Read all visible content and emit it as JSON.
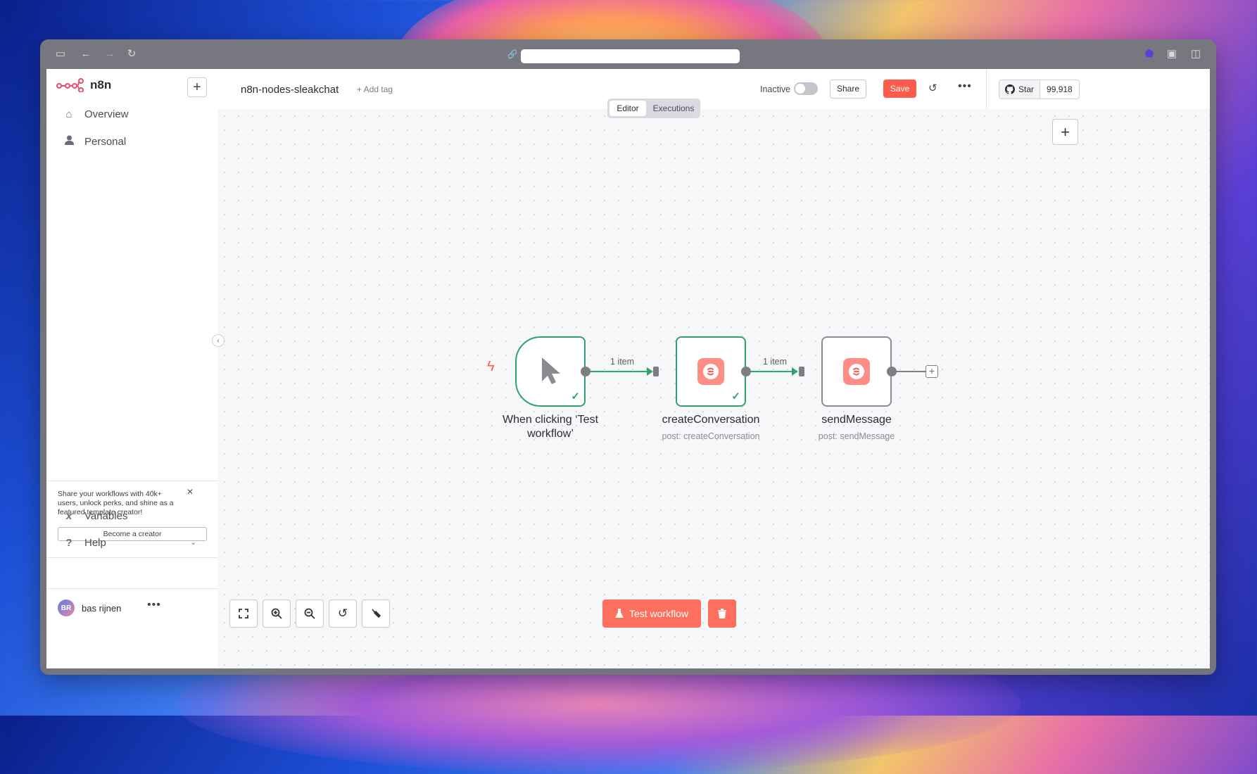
{
  "app": {
    "logo_text": "n8n"
  },
  "sidebar": {
    "items": [
      {
        "label": "Overview",
        "icon": "home-icon"
      },
      {
        "label": "Personal",
        "icon": "user-icon"
      }
    ],
    "promo": {
      "text": "Share your workflows with 40k+ users, unlock perks, and shine as a featured template creator!",
      "button_label": "Become a creator"
    },
    "bottom_items": [
      {
        "label": "Variables",
        "icon": "variables-icon"
      },
      {
        "label": "Help",
        "icon": "help-icon"
      }
    ],
    "user": {
      "initials": "BR",
      "name": "bas rijnen"
    }
  },
  "header": {
    "workflow_name": "n8n-nodes-sleakchat",
    "add_tag_label": "+ Add tag",
    "status_label": "Inactive",
    "active": false,
    "share_label": "Share",
    "save_label": "Save",
    "github": {
      "star_label": "Star",
      "count": "99,918"
    },
    "tabs": [
      {
        "label": "Editor",
        "active": true
      },
      {
        "label": "Executions",
        "active": false
      }
    ]
  },
  "canvas": {
    "nodes": [
      {
        "id": "trigger",
        "label_line1": "When clicking ‘Test",
        "label_line2": "workflow’",
        "status": "success"
      },
      {
        "id": "createConversation",
        "label": "createConversation",
        "subtitle": "post: createConversation",
        "status": "success"
      },
      {
        "id": "sendMessage",
        "label": "sendMessage",
        "subtitle": "post: sendMessage",
        "status": "idle"
      }
    ],
    "edges": [
      {
        "from": "trigger",
        "to": "createConversation",
        "label": "1 item"
      },
      {
        "from": "createConversation",
        "to": "sendMessage",
        "label": "1 item"
      }
    ],
    "test_button_label": "Test workflow"
  },
  "colors": {
    "accent": "#ff5b4d",
    "success": "#2fa36b",
    "node_border": "#8a8a93",
    "canvas_bg": "#f6f7f9"
  }
}
